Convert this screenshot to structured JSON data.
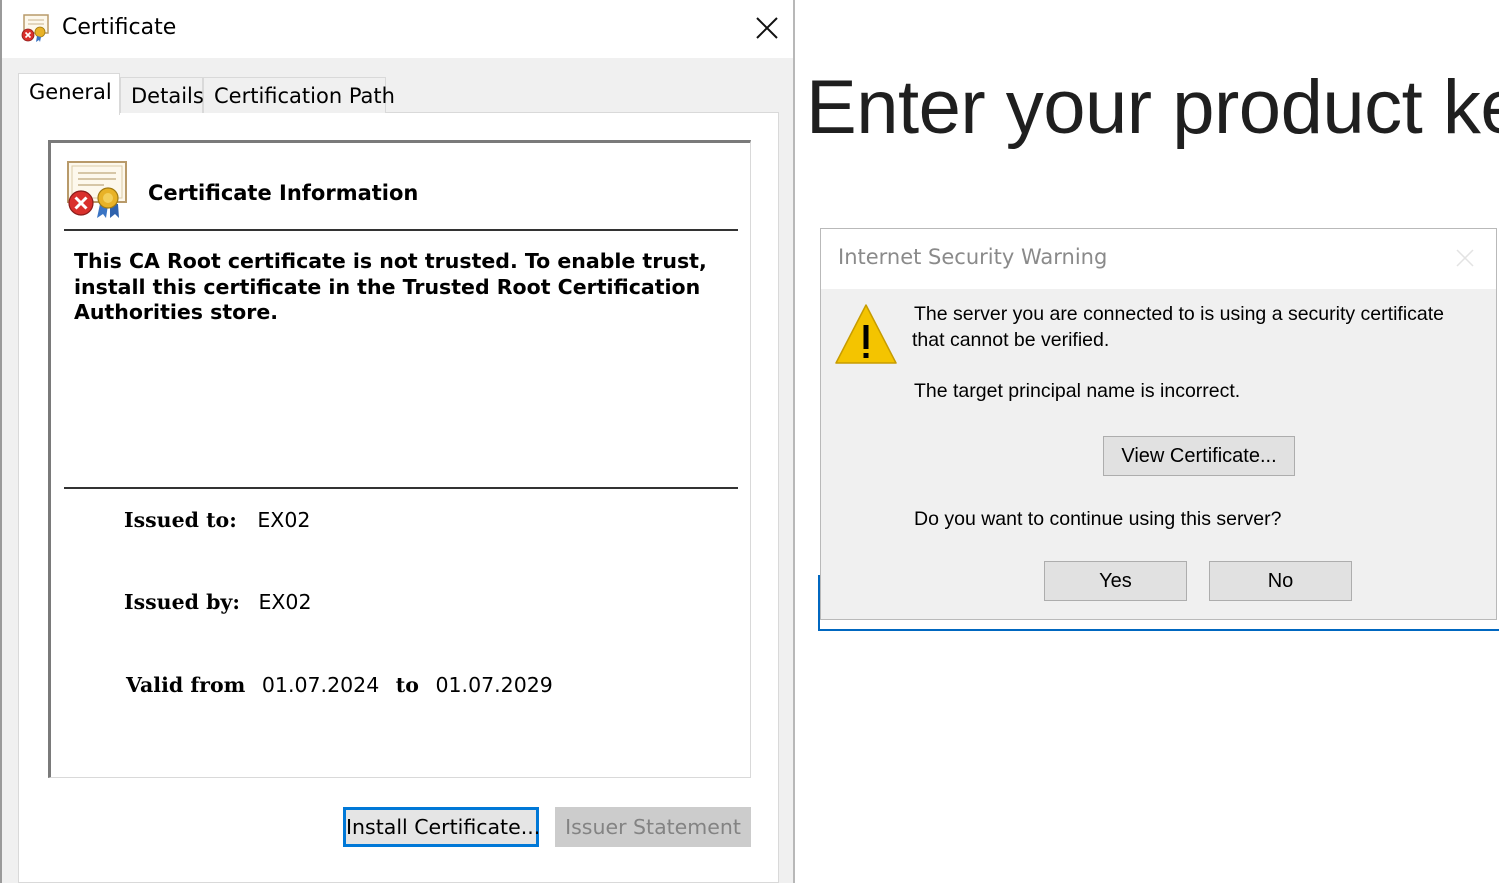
{
  "background": {
    "heading": "Enter your product ke"
  },
  "certificate_dialog": {
    "title": "Certificate",
    "tabs": [
      {
        "label": "General",
        "active": true
      },
      {
        "label": "Details",
        "active": false
      },
      {
        "label": "Certification Path",
        "active": false
      }
    ],
    "info": {
      "heading": "Certificate Information",
      "warning": "This CA Root certificate is not trusted. To enable trust, install this certificate in the Trusted Root Certification Authorities store.",
      "issued_to_label": "Issued to:",
      "issued_to_value": "EX02",
      "issued_by_label": "Issued by:",
      "issued_by_value": "EX02",
      "valid_from_label": "Valid from",
      "valid_from_value": "01.07.2024",
      "valid_to_label": "to",
      "valid_to_value": "01.07.2029"
    },
    "buttons": {
      "install": "Install Certificate...",
      "issuer": "Issuer Statement"
    }
  },
  "security_warning": {
    "title": "Internet Security Warning",
    "message_line1": "The server you are connected to is using a security certificate",
    "message_line2": "that cannot be verified.",
    "detail": "The target principal name is incorrect.",
    "view_certificate": "View Certificate...",
    "question": "Do you want to continue using this server?",
    "yes": "Yes",
    "no": "No"
  },
  "colors": {
    "accent_blue": "#0078d7",
    "warning_yellow": "#f4c400",
    "error_red": "#d9302c"
  }
}
